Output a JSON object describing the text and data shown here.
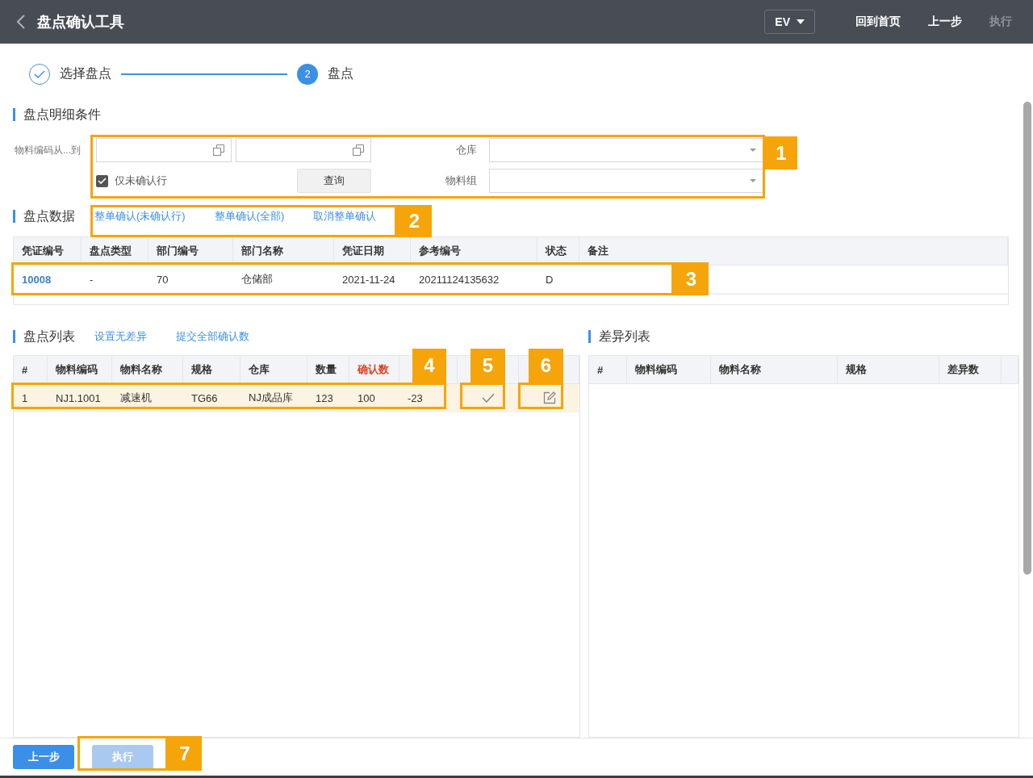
{
  "header": {
    "title": "盘点确认工具",
    "env": "EV",
    "actions": [
      {
        "label": "回到首页",
        "disabled": false
      },
      {
        "label": "上一步",
        "disabled": false
      },
      {
        "label": "执行",
        "disabled": true
      }
    ]
  },
  "steps": [
    {
      "label": "选择盘点",
      "done": true
    },
    {
      "label": "盘点",
      "done": false,
      "number": "2"
    }
  ],
  "filter": {
    "title": "盘点明细条件",
    "range_label": "物料编码从...到",
    "only_unconfirmed": {
      "label": "仅未确认行",
      "checked": true
    },
    "query_button": "查询",
    "warehouse": {
      "label": "仓库"
    },
    "material_group": {
      "label": "物料组"
    }
  },
  "stock_data": {
    "title": "盘点数据",
    "actions": [
      "整单确认(未确认行)",
      "整单确认(全部)",
      "取消整单确认"
    ],
    "columns": [
      {
        "label": "凭证编号"
      },
      {
        "label": "盘点类型"
      },
      {
        "label": "部门编号"
      },
      {
        "label": "部门名称"
      },
      {
        "label": "凭证日期"
      },
      {
        "label": "参考编号"
      },
      {
        "label": "状态"
      },
      {
        "label": "备注"
      }
    ],
    "rows": [
      {
        "selected": false,
        "cells": [
          {
            "text": "10008",
            "kind": "link"
          },
          {
            "text": "-",
            "kind": "text"
          },
          {
            "text": "70",
            "kind": "text"
          },
          {
            "text": "仓储部",
            "kind": "text"
          },
          {
            "text": "2021-11-24",
            "kind": "text"
          },
          {
            "text": "20211124135632",
            "kind": "text"
          },
          {
            "text": "D",
            "kind": "text"
          },
          {
            "kind": "empty"
          }
        ]
      }
    ]
  },
  "count_list": {
    "title": "盘点列表",
    "actions": [
      "设置无差异",
      "提交全部确认数"
    ],
    "columns": [
      {
        "label": "#"
      },
      {
        "label": "物料编码"
      },
      {
        "label": "物料名称"
      },
      {
        "label": "规格"
      },
      {
        "label": "仓库"
      },
      {
        "label": "数量"
      },
      {
        "label": "确认数",
        "highlight": true
      }
    ],
    "rows": [
      {
        "selected": true,
        "cells": [
          {
            "text": "1",
            "kind": "text"
          },
          {
            "text": "NJ1.1001",
            "kind": "text"
          },
          {
            "text": "减速机",
            "kind": "text"
          },
          {
            "text": "TG66",
            "kind": "text"
          },
          {
            "text": "NJ成品库",
            "kind": "text"
          },
          {
            "text": "123",
            "kind": "text"
          },
          {
            "text": "100",
            "kind": "text"
          },
          {
            "text": "-23",
            "kind": "text"
          },
          {
            "kind": "confirm"
          },
          {
            "kind": "edit"
          }
        ]
      }
    ]
  },
  "diff_list": {
    "title": "差异列表",
    "columns": [
      {
        "label": "#"
      },
      {
        "label": "物料编码"
      },
      {
        "label": "物料名称"
      },
      {
        "label": "规格"
      },
      {
        "label": "差异数"
      }
    ]
  },
  "footer": {
    "buttons": [
      {
        "label": "上一步",
        "disabled": false
      },
      {
        "label": "执行",
        "disabled": true
      }
    ]
  },
  "callouts": [
    "1",
    "2",
    "3",
    "4",
    "5",
    "6",
    "7"
  ]
}
